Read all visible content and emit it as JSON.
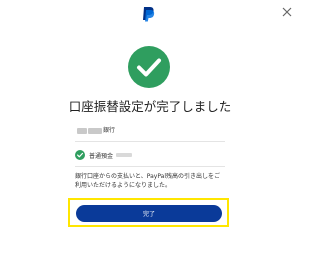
{
  "header": {
    "logo_icon": "paypal-logo-icon",
    "close_icon": "close-icon"
  },
  "confirmation": {
    "icon": "checkmark-circle-icon",
    "title": "口座振替設定が完了しました",
    "bank_name": "銀行",
    "account_type": "普通預金",
    "description": "銀行口座からの支払いと、PayPal残高の引き出しをご利用いただけるようになりました。"
  },
  "actions": {
    "done_label": "完了"
  },
  "colors": {
    "success": "#2f9e5f",
    "button": "#0a3a99",
    "highlight": "#ffe600"
  }
}
